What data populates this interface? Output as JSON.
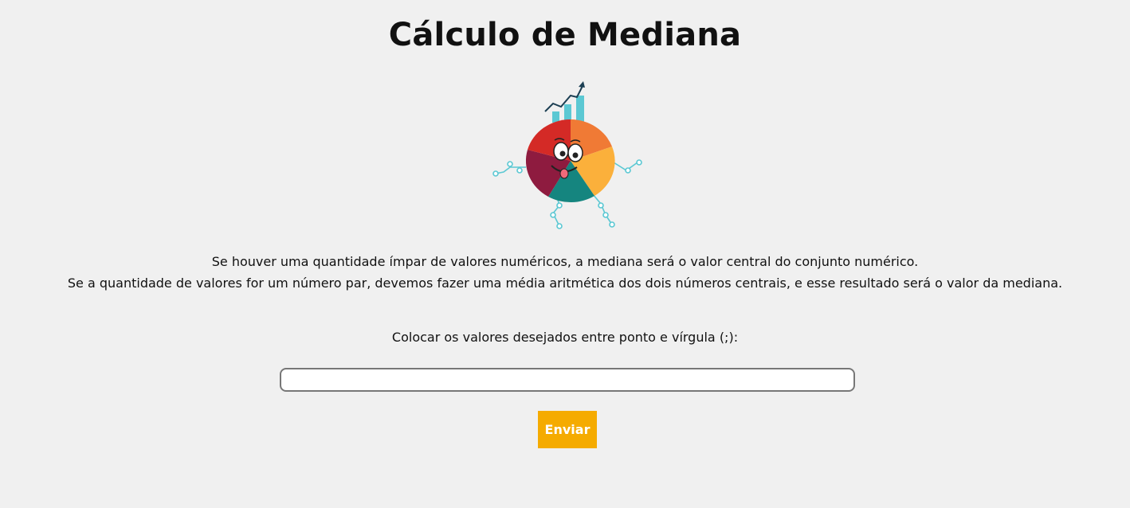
{
  "page": {
    "title": "Cálculo de Mediana"
  },
  "description": {
    "line1": "Se houver uma quantidade ímpar de valores numéricos, a mediana será o valor central do conjunto numérico.",
    "line2": "Se a quantidade de valores for um número par, devemos fazer uma média aritmética dos dois números centrais, e esse resultado será o valor da mediana."
  },
  "form": {
    "input_label": "Colocar os valores desejados entre ponto e vírgula (;):",
    "input_value": "",
    "submit_label": "Enviar"
  },
  "colors": {
    "background": "#f0f0f0",
    "button": "#f5ab00",
    "button_text": "#ffffff"
  },
  "mascot": {
    "icon": "pie-chart-mascot-icon"
  }
}
